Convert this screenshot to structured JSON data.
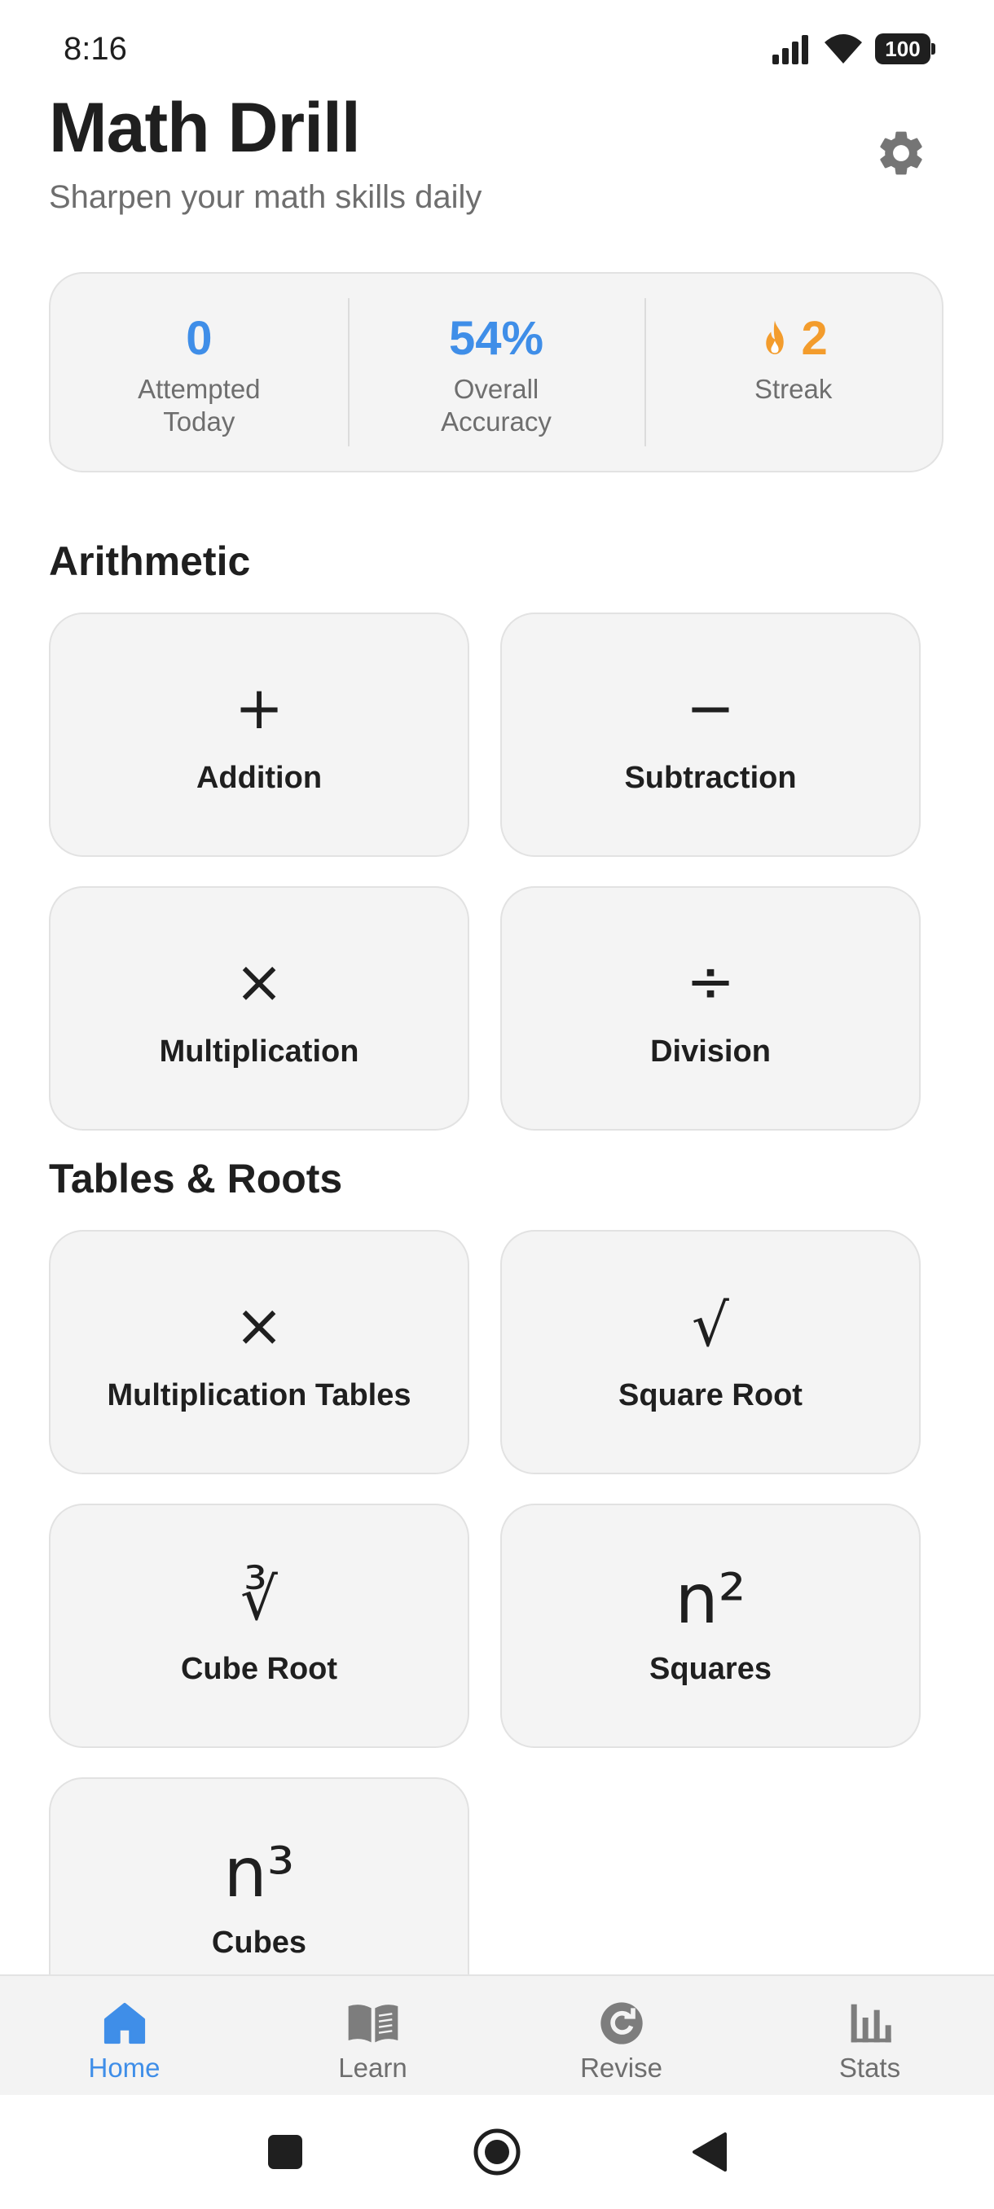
{
  "status_bar": {
    "time": "8:16",
    "battery": "100"
  },
  "header": {
    "title": "Math Drill",
    "subtitle": "Sharpen your math skills daily",
    "settings_icon": "gear-icon"
  },
  "stats": [
    {
      "value": "0",
      "label": "Attempted Today"
    },
    {
      "value": "54%",
      "label": "Overall Accuracy"
    },
    {
      "value": "2",
      "label": "Streak",
      "icon": "flame-icon"
    }
  ],
  "sections": {
    "arithmetic": {
      "title": "Arithmetic",
      "tiles": [
        {
          "symbol": "+",
          "label": "Addition"
        },
        {
          "symbol": "−",
          "label": "Subtraction"
        },
        {
          "symbol": "×",
          "label": "Multiplication"
        },
        {
          "symbol": "÷",
          "label": "Division"
        }
      ]
    },
    "tables_roots": {
      "title": "Tables & Roots",
      "tiles": [
        {
          "symbol": "×",
          "label": "Multiplication Tables"
        },
        {
          "symbol": "√",
          "label": "Square Root"
        },
        {
          "symbol": "∛",
          "label": "Cube Root"
        },
        {
          "symbol": "n²",
          "label": "Squares"
        },
        {
          "symbol": "n³",
          "label": "Cubes"
        }
      ]
    }
  },
  "bottom_nav": [
    {
      "label": "Home",
      "icon": "home-icon",
      "active": true
    },
    {
      "label": "Learn",
      "icon": "book-icon",
      "active": false
    },
    {
      "label": "Revise",
      "icon": "refresh-icon",
      "active": false
    },
    {
      "label": "Stats",
      "icon": "bar-chart-icon",
      "active": false
    }
  ],
  "colors": {
    "accent": "#3f8ee8",
    "streak": "#f39c2c",
    "card_bg": "#f4f4f4",
    "muted_text": "#6e6e6e"
  }
}
